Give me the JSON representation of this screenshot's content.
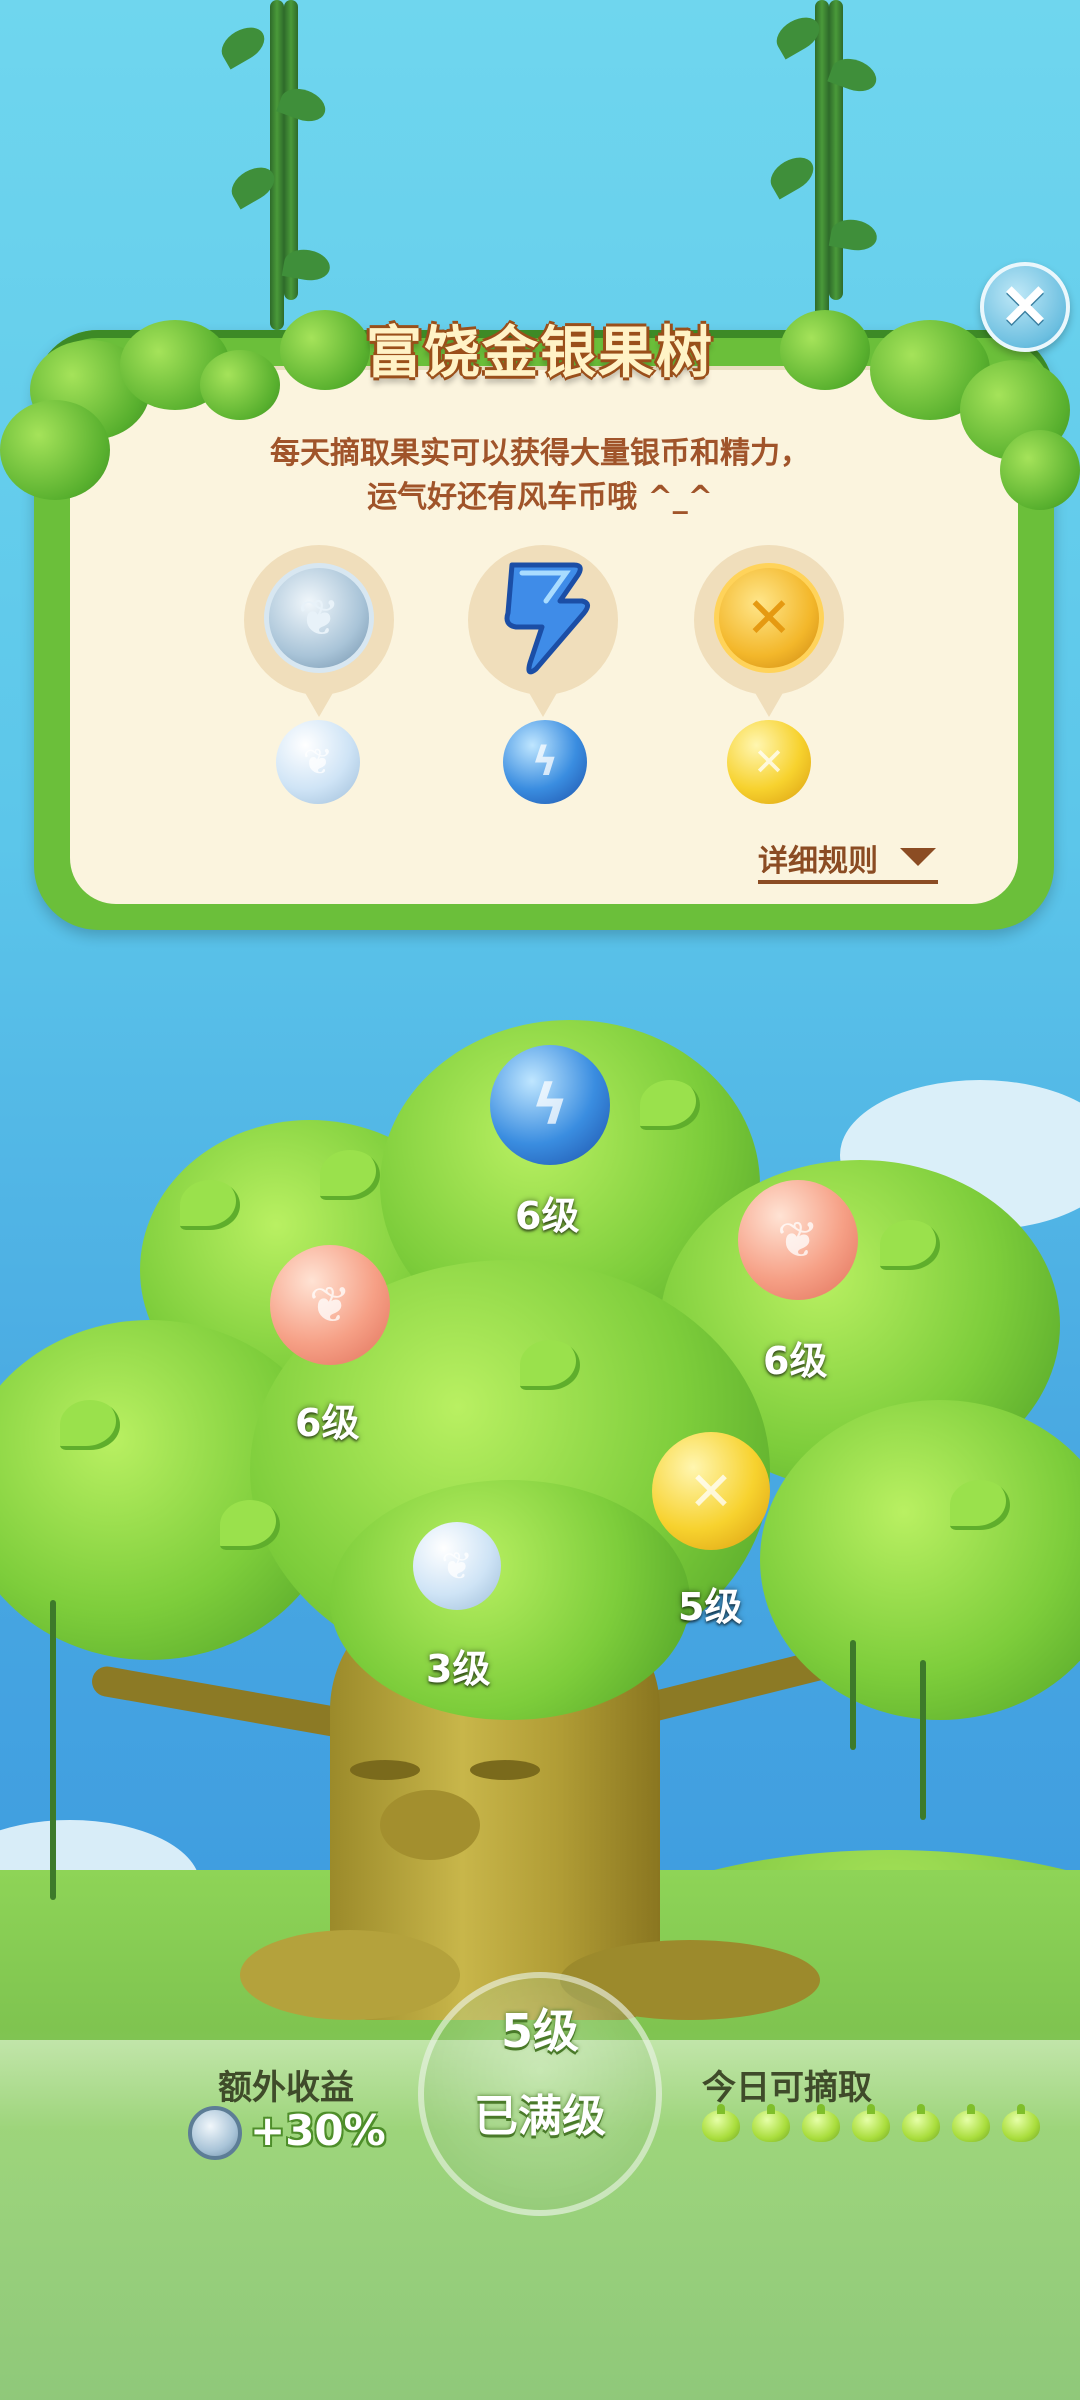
{
  "panel": {
    "title": "富饶金银果树",
    "desc_line1": "每天摘取果实可以获得大量银币和精力，",
    "desc_line2": "运气好还有风车币哦 ^_^",
    "rules_link": "详细规则",
    "rewards": [
      {
        "icon": "silver-coin-icon",
        "fruit": "silver-fruit-icon"
      },
      {
        "icon": "lightning-energy-icon",
        "fruit": "blue-energy-fruit-icon"
      },
      {
        "icon": "windmill-coin-icon",
        "fruit": "gold-windmill-fruit-icon"
      }
    ]
  },
  "close_icon": "close-icon",
  "tree": {
    "fruits": [
      {
        "kind": "blue-energy",
        "label": "6级"
      },
      {
        "kind": "peach-silver",
        "label": "6级"
      },
      {
        "kind": "peach-silver",
        "label": "6级"
      },
      {
        "kind": "gold-windmill",
        "label": "5级"
      },
      {
        "kind": "silver",
        "label": "3级"
      }
    ]
  },
  "bottom": {
    "bonus_label": "额外收益",
    "bonus_value": "+30%",
    "level": "5级",
    "status": "已满级",
    "pick_label": "今日可摘取",
    "pick_count": 7
  },
  "colors": {
    "panel_green": "#6bbf3a",
    "panel_cream": "#fbf4de",
    "text_brown": "#a0542a",
    "sky": "#5cc6ea"
  }
}
